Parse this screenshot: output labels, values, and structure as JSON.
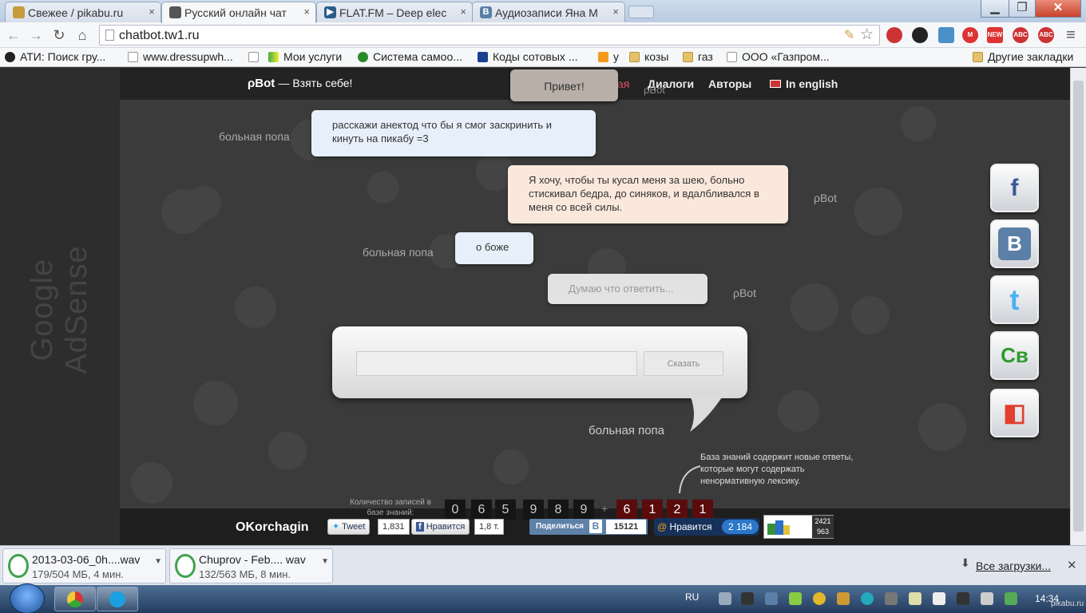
{
  "tabs": [
    {
      "label": "Свежее / pikabu.ru",
      "icon_color": "#c79a3a"
    },
    {
      "label": "Русский онлайн чат",
      "icon_color": "#555555"
    },
    {
      "label": "FLAT.FM – Deep elec",
      "icon_color": "#2a5d87"
    },
    {
      "label": "Аудиозаписи Яна М",
      "icon_color": "#5b7fa6"
    }
  ],
  "address": {
    "url": "chatbot.tw1.ru"
  },
  "extensions": [
    {
      "label": "NEW",
      "color": "#d33"
    },
    {
      "label": "ABC",
      "color": "#c33"
    },
    {
      "label": "ABC",
      "color": "#c33"
    }
  ],
  "bookmarks": [
    "АТИ: Поиск гру...",
    "www.dressupwh...",
    "Мои услуги",
    "Система самоо...",
    "Коды сотовых ...",
    "у",
    "козы",
    "газ",
    "ООО «Газпром...",
    "Другие закладки"
  ],
  "site": {
    "logo": "ρBot",
    "tagline": "— Взять себе!",
    "nav": {
      "home": "Главная",
      "dialogs": "Диалоги",
      "authors": "Авторы",
      "english": "In english"
    },
    "hello": "Привет!",
    "hello_who": "ρBot",
    "adsense": "Google AdSense"
  },
  "chat": [
    {
      "who": "больная попа",
      "text": "расскажи анектод что бы я смог заскринить и кинуть на пикабу =3"
    },
    {
      "who": "ρBot",
      "text": "Я хочу, чтобы ты кусал меня за шею, больно стискивал бедра, до синяков, и вдалбливался в меня со всей силы."
    },
    {
      "who": "больная попа",
      "text": "о боже"
    },
    {
      "who": "ρBot",
      "text": "Думаю что ответить..."
    }
  ],
  "input": {
    "value": "",
    "button": "Сказать",
    "who": "больная попа"
  },
  "note": "База знаний содержит новые ответы, которые могут содержать ненормативную лексику.",
  "counter": {
    "label": "Количество записей в базе знаний:",
    "digits": [
      "0",
      "6",
      "5",
      "9",
      "8",
      "9"
    ],
    "plus": "+",
    "new_digits": [
      "6",
      "1",
      "2",
      "1"
    ]
  },
  "footer": {
    "brand": "OKorchagin",
    "tweet": "Tweet",
    "tweet_count": "1,831",
    "fb": "Нравится",
    "fb_count": "1,8 т.",
    "vk": "Поделиться",
    "vk_b": "B",
    "vk_count": "15121",
    "mailru": "Нравится",
    "mailru_count": "2 184",
    "liru_a": "2421",
    "liru_b": "963"
  },
  "side": [
    {
      "name": "facebook",
      "glyph": "f",
      "color": "#3b5998"
    },
    {
      "name": "vkontakte",
      "glyph": "B",
      "color": "#5b7fa6"
    },
    {
      "name": "twitter",
      "glyph": "t",
      "color": "#4ab3f4"
    },
    {
      "name": "cb",
      "glyph": "Св",
      "color": "#2d9b2d"
    },
    {
      "name": "chrome-store",
      "glyph": "◧",
      "color": "#e04030"
    }
  ],
  "downloads": [
    {
      "name": "2013-03-06_0h....wav",
      "size": "179/504 МБ, 4 мин."
    },
    {
      "name": "Chuprov - Feb.... wav",
      "size": "132/563 МБ, 8 мин."
    }
  ],
  "downloads_all": "Все загрузки...",
  "taskbar": {
    "lang": "RU",
    "clock": "14:34",
    "watermark": "pikabu.ru"
  }
}
